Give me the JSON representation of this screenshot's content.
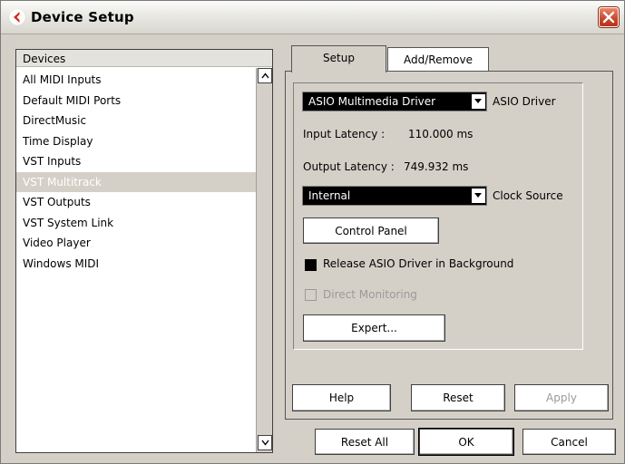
{
  "window": {
    "title": "Device Setup"
  },
  "devices": {
    "header": "Devices",
    "items": [
      "All MIDI Inputs",
      "Default MIDI Ports",
      "DirectMusic",
      "Time Display",
      "VST Inputs",
      "VST Multitrack",
      "VST Outputs",
      "VST System Link",
      "Video Player",
      "Windows MIDI"
    ],
    "selected": "VST Multitrack"
  },
  "tabs": [
    {
      "label": "Setup",
      "active": true
    },
    {
      "label": "Add/Remove",
      "active": false
    }
  ],
  "setup": {
    "driver_value": "ASIO Multimedia Driver",
    "driver_label": "ASIO Driver",
    "input_latency_label": "Input Latency :",
    "input_latency_value": "110.000 ms",
    "output_latency_label": "Output Latency :",
    "output_latency_value": "749.932 ms",
    "clock_value": "Internal",
    "clock_label": "Clock Source",
    "control_panel_label": "Control Panel",
    "release_label": "Release ASIO Driver in Background",
    "release_checked": true,
    "direct_monitoring_label": "Direct Monitoring",
    "direct_monitoring_checked": false,
    "direct_monitoring_enabled": false,
    "expert_label": "Expert..."
  },
  "panel_buttons": {
    "help": "Help",
    "reset": "Reset",
    "apply": "Apply"
  },
  "dialog_buttons": {
    "reset_all": "Reset All",
    "ok": "OK",
    "cancel": "Cancel"
  },
  "colors": {
    "dialog_face": "#d4d0c8",
    "selected_row": "#d4d0c8",
    "combo_background": "#000000",
    "close_button": "#c8452a",
    "app_icon": "#d8281c"
  },
  "icons": {
    "app": "cubase-arrow-icon",
    "close": "close-x-icon",
    "scroll_up": "scroll-up-arrow-icon",
    "scroll_down": "scroll-down-arrow-icon",
    "dropdown": "dropdown-arrow-icon"
  }
}
